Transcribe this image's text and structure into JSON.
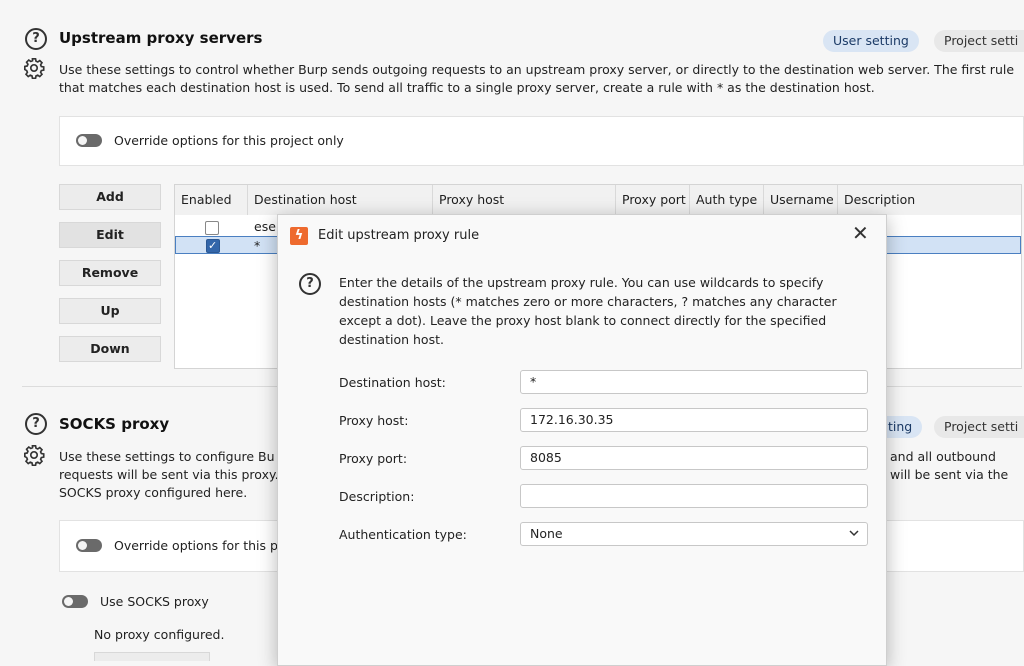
{
  "upstream": {
    "title": "Upstream proxy servers",
    "description_line1": "Use these settings to control whether Burp sends outgoing requests to an upstream proxy server, or directly to the destination web server. The first rule",
    "description_line2": "that matches each destination host is used. To send all traffic to a single proxy server, create a rule with * as the destination host.",
    "tab_user": "User setting",
    "tab_project": "Project setti",
    "override_label": "Override options for this project only",
    "buttons": {
      "add": "Add",
      "edit": "Edit",
      "remove": "Remove",
      "up": "Up",
      "down": "Down"
    },
    "columns": [
      "Enabled",
      "Destination host",
      "Proxy host",
      "Proxy port",
      "Auth type",
      "Username",
      "Description"
    ],
    "rows": [
      {
        "enabled": false,
        "destination": "eser"
      },
      {
        "enabled": true,
        "destination": "*"
      }
    ]
  },
  "socks": {
    "title": "SOCKS proxy",
    "description_line1": "Use these settings to configure Bu",
    "description_line2": "requests will be sent via this proxy.",
    "description_line3": "SOCKS proxy configured here.",
    "right_line1": "and all outbound",
    "right_line2": "will be sent via the",
    "tab_user_partial": "ting",
    "tab_project": "Project setti",
    "override_label": "Override options for this p",
    "use_socks_label": "Use SOCKS proxy",
    "status": "No proxy configured."
  },
  "dialog": {
    "title": "Edit upstream proxy rule",
    "close": "✕",
    "intro_line1": "Enter the details of the upstream proxy rule. You can use wildcards to specify",
    "intro_line2": "destination hosts (* matches zero or more characters, ? matches any character",
    "intro_line3": "except a dot). Leave the proxy host blank to connect directly for the specified",
    "intro_line4": "destination host.",
    "labels": {
      "destination_host": "Destination host:",
      "proxy_host": "Proxy host:",
      "proxy_port": "Proxy port:",
      "description": "Description:",
      "auth_type": "Authentication type:"
    },
    "values": {
      "destination_host": "*",
      "proxy_host": "172.16.30.35",
      "proxy_port": "8085",
      "description": "",
      "auth_type": "None"
    }
  },
  "icons": {
    "help": "?",
    "settings": "gear-icon",
    "logo": "burp-logo-icon"
  },
  "colors": {
    "accent": "#3366aa",
    "logo": "#ee6a2e",
    "selection": "#d2e2f5"
  }
}
